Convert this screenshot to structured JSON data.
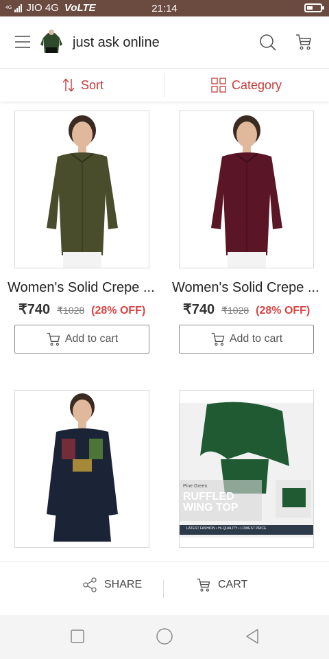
{
  "status_bar": {
    "network_type": "4G",
    "carrier": "JIO 4G",
    "volte": "VoLTE",
    "time": "21:14",
    "battery_level": 0.45
  },
  "header": {
    "title": "just ask online"
  },
  "toolbar": {
    "sort_label": "Sort",
    "category_label": "Category"
  },
  "products": [
    {
      "title": "Women's Solid Crepe ...",
      "price": "₹740",
      "mrp": "₹1028",
      "discount": "(28% OFF)",
      "add_label": "Add to cart",
      "color": "#4a4d2c"
    },
    {
      "title": "Women's Solid Crepe ...",
      "price": "₹740",
      "mrp": "₹1028",
      "discount": "(28% OFF)",
      "add_label": "Add to cart",
      "color": "#5a1626"
    },
    {
      "color": "#1b2336"
    },
    {
      "color": "#1f5a33",
      "banner_lines": [
        "RUFFLED",
        "WING TOP"
      ],
      "banner_small": "Pine Green",
      "banner_footer": "LATEST FASHION • HI-QUALITY • LOWEST PRICE"
    }
  ],
  "bottom_bar": {
    "share_label": "SHARE",
    "cart_label": "CART"
  },
  "colors": {
    "accent": "#c73a3a",
    "status_bar": "#6b4a3f"
  }
}
